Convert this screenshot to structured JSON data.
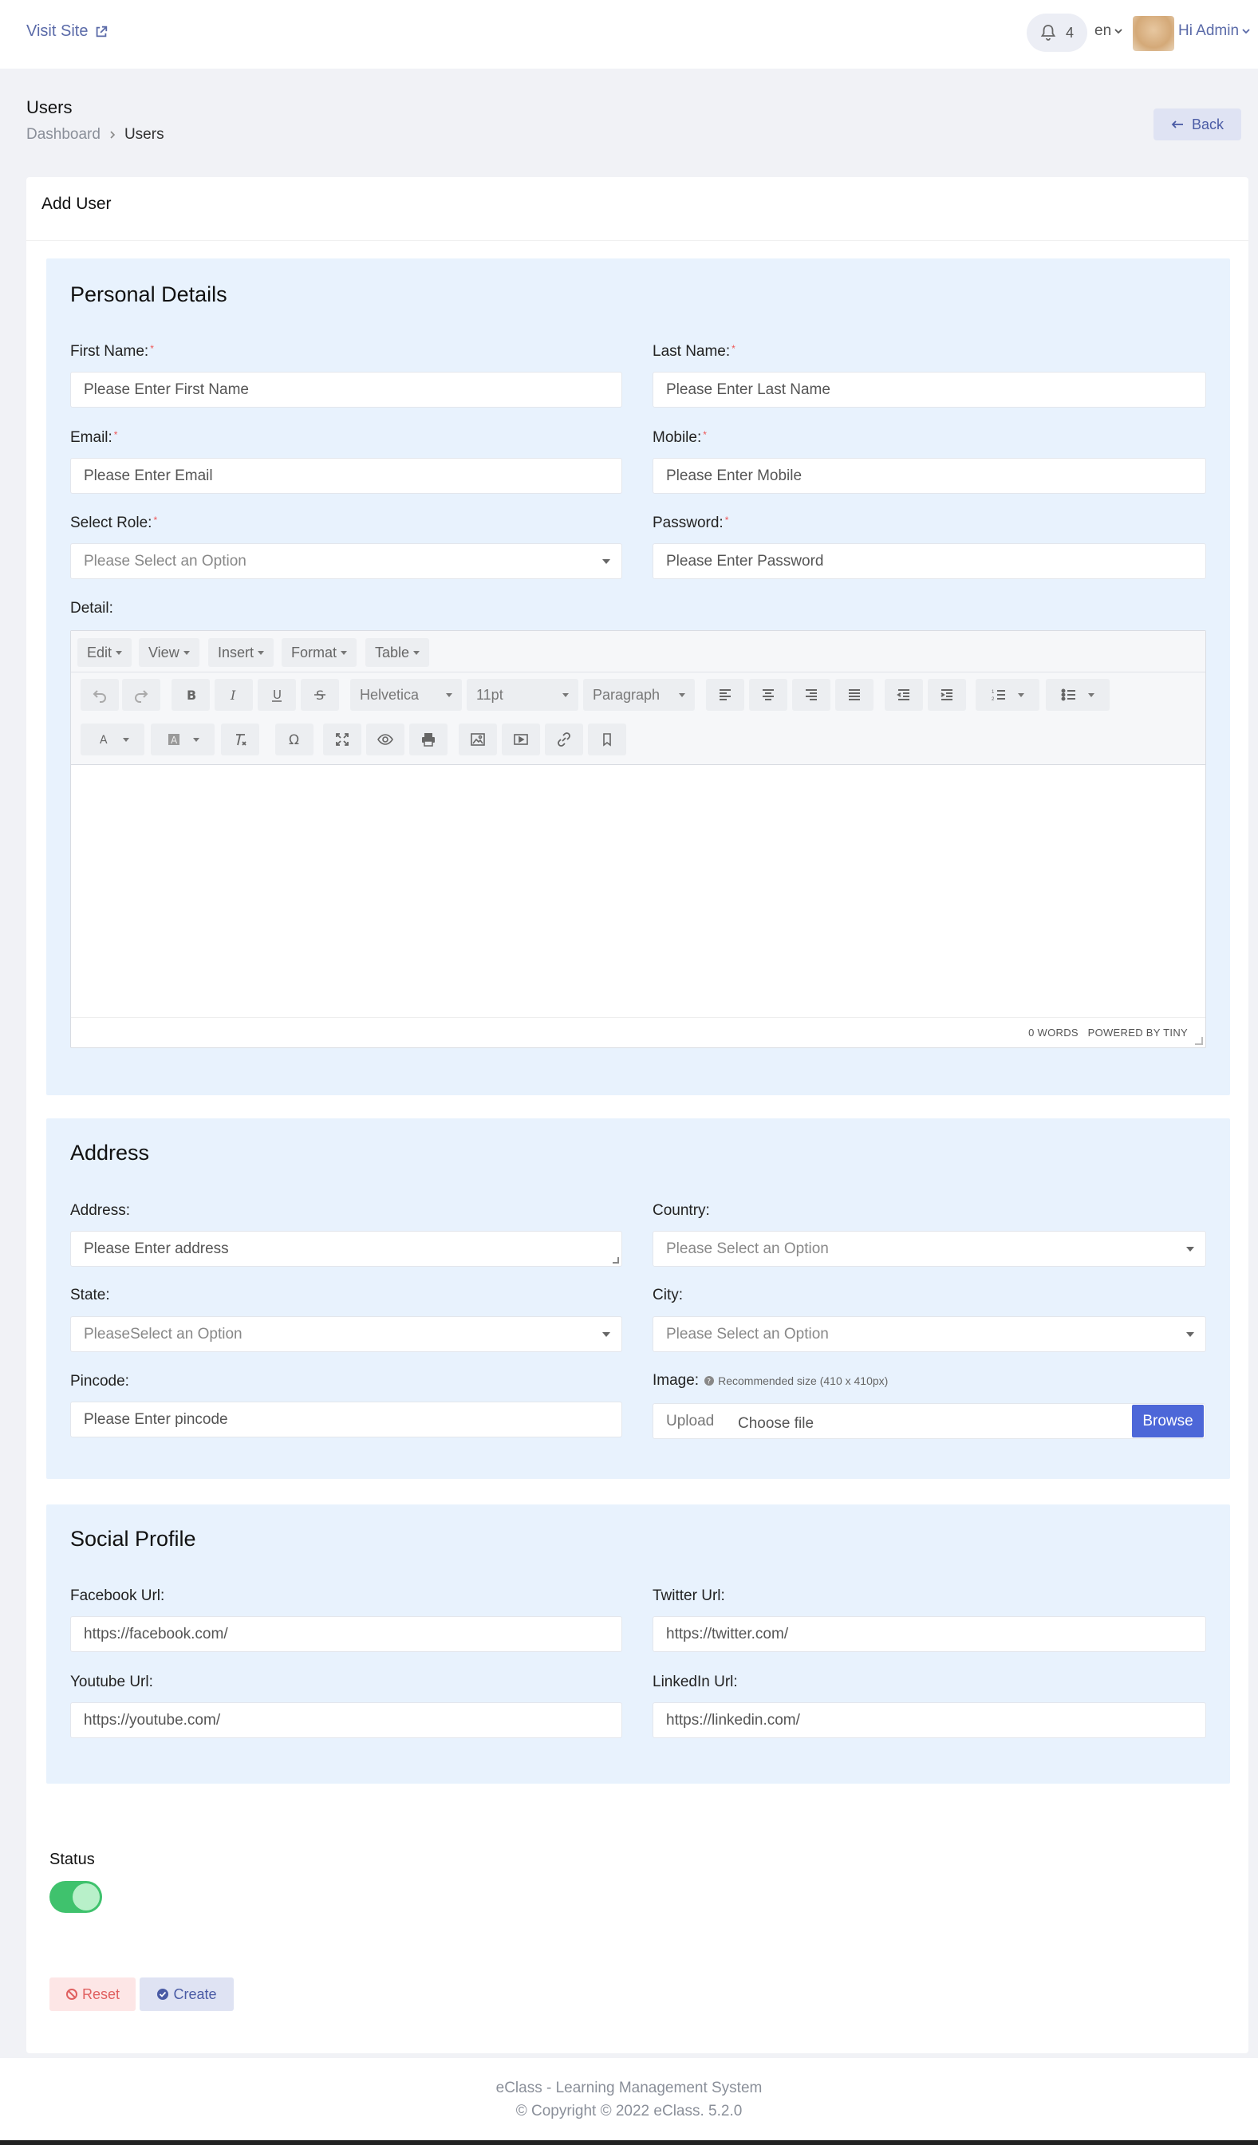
{
  "topbar": {
    "visit_site": "Visit Site",
    "notification_count": "4",
    "language": "en",
    "user_greeting": "Hi Admin"
  },
  "page": {
    "title": "Users",
    "breadcrumb": [
      "Dashboard",
      "Users"
    ],
    "back_label": "Back"
  },
  "card": {
    "title": "Add User"
  },
  "personal": {
    "title": "Personal Details",
    "first_name": {
      "label": "First Name:",
      "required": "*",
      "placeholder": "Please Enter First Name"
    },
    "last_name": {
      "label": "Last Name:",
      "required": "*",
      "placeholder": "Please Enter Last Name"
    },
    "email": {
      "label": "Email:",
      "required": "*",
      "placeholder": "Please Enter Email"
    },
    "mobile": {
      "label": "Mobile:",
      "required": "*",
      "placeholder": "Please Enter Mobile"
    },
    "role": {
      "label": "Select Role:",
      "required": "*",
      "placeholder": "Please Select an Option"
    },
    "password": {
      "label": "Password:",
      "required": "*",
      "placeholder": "Please Enter Password"
    },
    "detail": {
      "label": "Detail:"
    }
  },
  "editor": {
    "menus": [
      "Edit",
      "View",
      "Insert",
      "Format",
      "Table"
    ],
    "font_family": "Helvetica",
    "font_size": "11pt",
    "block_format": "Paragraph",
    "word_count": "0 WORDS",
    "powered_by": "POWERED BY TINY"
  },
  "address": {
    "title": "Address",
    "address": {
      "label": "Address:",
      "placeholder": "Please Enter address"
    },
    "country": {
      "label": "Country:",
      "placeholder": "Please Select an Option"
    },
    "state": {
      "label": "State:",
      "placeholder": "PleaseSelect an Option"
    },
    "city": {
      "label": "City:",
      "placeholder": "Please Select an Option"
    },
    "pincode": {
      "label": "Pincode:",
      "placeholder": "Please Enter pincode"
    },
    "image": {
      "label": "Image:",
      "hint": "Recommended size (410 x 410px)",
      "upload": "Upload",
      "choose": "Choose file",
      "browse": "Browse"
    }
  },
  "social": {
    "title": "Social Profile",
    "facebook": {
      "label": "Facebook Url:",
      "placeholder": "https://facebook.com/"
    },
    "twitter": {
      "label": "Twitter Url:",
      "placeholder": "https://twitter.com/"
    },
    "youtube": {
      "label": "Youtube Url:",
      "placeholder": "https://youtube.com/"
    },
    "linkedin": {
      "label": "LinkedIn Url:",
      "placeholder": "https://linkedin.com/"
    }
  },
  "status": {
    "label": "Status",
    "enabled": true
  },
  "actions": {
    "reset": "Reset",
    "create": "Create"
  },
  "footer": {
    "line1": "eClass - Learning Management System",
    "line2": "© Copyright © 2022 eClass. 5.2.0"
  },
  "colors": {
    "accent": "#4d67d8",
    "section_bg": "#e8f2fd",
    "toggle_on": "#3fc26d",
    "reset": "#e06060"
  }
}
